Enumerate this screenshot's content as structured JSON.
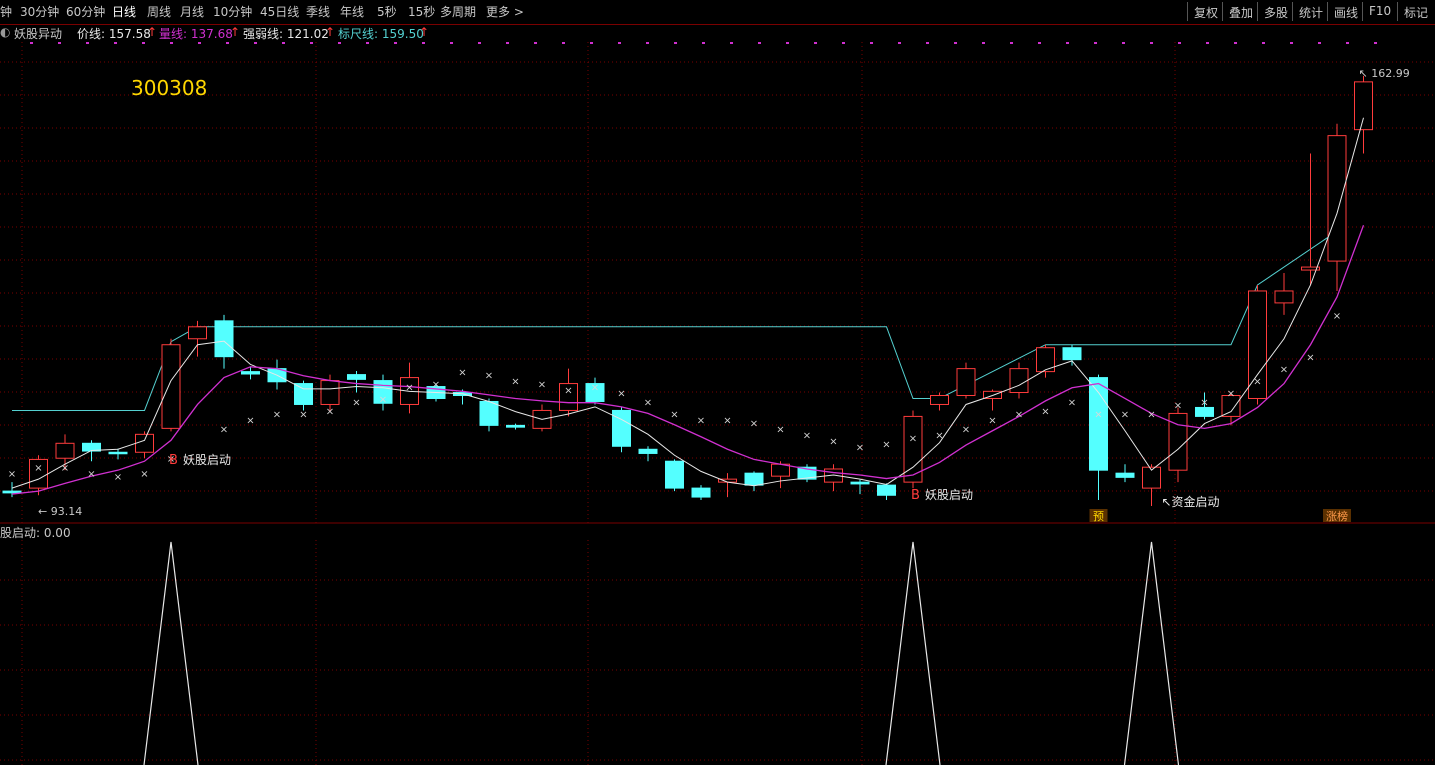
{
  "toolbar": {
    "periods": [
      "钟",
      "30分钟",
      "60分钟",
      "日线",
      "周线",
      "月线",
      "10分钟",
      "45日线",
      "季线",
      "年线",
      "5秒",
      "15秒",
      "多周期",
      "更多 >"
    ],
    "active_period": "日线",
    "right_buttons": [
      "复权",
      "叠加",
      "多股",
      "统计",
      "画线",
      "F10",
      "标记"
    ]
  },
  "legend": {
    "indicator_name": "妖股异动",
    "price_line": "价线: 157.58",
    "volume_line": "量线: 137.68",
    "strength_line": "强弱线: 121.02",
    "ruler_line": "标尺线: 159.50",
    "arrow": "↑"
  },
  "stock_code": "300308",
  "sub_indicator": "股启动: 0.00",
  "annotations": {
    "signal_b": "B",
    "yao_gu_qi_dong": "妖股启动",
    "zi_jin_qi_dong": "↖资金启动",
    "low_price": "93.14",
    "high_price": "162.99",
    "marker_yu": "预",
    "marker_zhang_bang": "涨榜"
  },
  "colors": {
    "up": "#ff3c3c",
    "down": "#54ffff",
    "ma_white": "#e8e8e8",
    "ma_magenta": "#d030d0",
    "ruler": "#54d0d0",
    "grid": "#7a0000",
    "yellow": "#ffd700"
  },
  "chart_data": {
    "type": "candlestick",
    "y_range": [
      90,
      167
    ],
    "candles": [
      [
        93.5,
        95.0,
        92.5,
        93.2
      ],
      [
        94.0,
        99.5,
        92.8,
        98.8
      ],
      [
        99.0,
        103.0,
        97.0,
        101.5
      ],
      [
        101.5,
        102.0,
        98.5,
        100.2
      ],
      [
        100.0,
        100.6,
        98.8,
        99.8
      ],
      [
        100.0,
        103.5,
        99.0,
        103.0
      ],
      [
        104.0,
        119.0,
        103.5,
        118.0
      ],
      [
        119.0,
        122.0,
        116.0,
        121.0
      ],
      [
        122.0,
        123.0,
        114.0,
        116.0
      ],
      [
        113.5,
        114.3,
        112.2,
        113.1
      ],
      [
        114.0,
        115.5,
        110.5,
        111.8
      ],
      [
        111.5,
        112.0,
        107.0,
        108.0
      ],
      [
        108.0,
        113.0,
        107.0,
        112.0
      ],
      [
        113.0,
        113.6,
        110.0,
        112.2
      ],
      [
        112.0,
        113.0,
        107.0,
        108.2
      ],
      [
        108.0,
        115.0,
        106.5,
        112.5
      ],
      [
        111.0,
        111.5,
        108.5,
        109.0
      ],
      [
        110.0,
        110.5,
        108.0,
        109.5
      ],
      [
        108.5,
        109.0,
        103.5,
        104.5
      ],
      [
        104.5,
        104.8,
        103.8,
        104.2
      ],
      [
        104.0,
        108.0,
        103.5,
        107.0
      ],
      [
        107.0,
        114.0,
        106.0,
        111.5
      ],
      [
        111.5,
        112.5,
        108.0,
        108.5
      ],
      [
        107.0,
        107.5,
        100.0,
        101.0
      ],
      [
        100.5,
        101.0,
        98.5,
        99.8
      ],
      [
        98.5,
        98.8,
        93.5,
        94.0
      ],
      [
        94.0,
        94.5,
        92.0,
        92.5
      ],
      [
        95.0,
        96.5,
        92.5,
        95.5
      ],
      [
        96.5,
        96.8,
        93.5,
        94.5
      ],
      [
        96.0,
        98.5,
        94.0,
        98.0
      ],
      [
        97.5,
        98.0,
        95.0,
        95.5
      ],
      [
        95.0,
        98.0,
        93.5,
        97.2
      ],
      [
        95.0,
        95.4,
        93.0,
        94.7
      ],
      [
        94.5,
        94.8,
        92.0,
        92.8
      ],
      [
        95.0,
        107.0,
        94.0,
        106.0
      ],
      [
        108.0,
        110.0,
        107.0,
        109.5
      ],
      [
        109.5,
        115.0,
        109.0,
        114.0
      ],
      [
        109.0,
        110.5,
        107.0,
        110.2
      ],
      [
        110.0,
        115.0,
        109.0,
        114.0
      ],
      [
        113.5,
        118.0,
        112.5,
        117.5
      ],
      [
        117.5,
        118.0,
        114.5,
        115.5
      ],
      [
        112.5,
        113.0,
        92.0,
        97.0
      ],
      [
        96.5,
        98.0,
        95.0,
        95.8
      ],
      [
        94.0,
        98.0,
        91.0,
        97.5
      ],
      [
        97.0,
        107.5,
        95.0,
        106.5
      ],
      [
        107.5,
        110.0,
        105.5,
        106.0
      ],
      [
        106.0,
        110.0,
        104.5,
        109.5
      ],
      [
        109.0,
        128.0,
        108.0,
        127.0
      ],
      [
        125.0,
        130.0,
        123.0,
        127.0
      ],
      [
        130.5,
        150.0,
        128.0,
        131.0
      ],
      [
        132.0,
        155.0,
        127.0,
        153.0
      ],
      [
        154.0,
        163.0,
        150.0,
        162.0
      ]
    ],
    "ma_white": [
      94.0,
      95.5,
      98.0,
      100.3,
      100.5,
      102.0,
      112.0,
      118.0,
      118.6,
      114.7,
      112.9,
      110.6,
      110.6,
      111.0,
      110.8,
      110.2,
      110.0,
      109.8,
      108.5,
      106.8,
      105.5,
      106.4,
      107.6,
      105.5,
      103.0,
      99.5,
      96.8,
      95.0,
      94.4,
      95.2,
      95.7,
      96.2,
      95.5,
      94.6,
      97.5,
      101.6,
      108.0,
      109.5,
      111.2,
      113.8,
      115.3,
      110.0,
      103.6,
      97.0,
      100.5,
      104.8,
      106.8,
      113.0,
      119.0,
      128.0,
      140.0,
      156.0
    ],
    "ma_magenta": [
      93.0,
      93.5,
      94.8,
      96.0,
      97.0,
      98.5,
      102.0,
      108.0,
      112.5,
      114.3,
      114.0,
      112.8,
      112.0,
      111.5,
      111.2,
      111.0,
      110.6,
      110.2,
      109.6,
      109.0,
      108.6,
      108.3,
      108.3,
      107.6,
      106.5,
      104.6,
      102.6,
      100.5,
      98.8,
      98.0,
      97.2,
      96.6,
      96.2,
      95.6,
      96.2,
      98.3,
      101.2,
      103.6,
      106.0,
      108.6,
      110.8,
      111.5,
      109.0,
      106.5,
      104.6,
      104.0,
      104.8,
      107.5,
      111.5,
      118.0,
      126.0,
      138.0
    ],
    "ruler": [
      [
        0,
        107
      ],
      [
        5,
        107
      ],
      [
        6,
        118.5
      ],
      [
        7,
        121
      ],
      [
        33,
        121
      ],
      [
        34,
        109
      ],
      [
        35,
        109
      ],
      [
        39,
        118
      ],
      [
        46,
        118
      ],
      [
        47,
        128
      ],
      [
        50,
        137
      ]
    ],
    "x_marks": [
      [
        0,
        96.5
      ],
      [
        1,
        97.5
      ],
      [
        2,
        97.5
      ],
      [
        3,
        96.5
      ],
      [
        4,
        96.0
      ],
      [
        5,
        96.5
      ],
      [
        6,
        99.0
      ],
      [
        8,
        104.0
      ],
      [
        9,
        105.5
      ],
      [
        10,
        106.5
      ],
      [
        11,
        106.5
      ],
      [
        12,
        107.0
      ],
      [
        13,
        108.5
      ],
      [
        14,
        109.0
      ],
      [
        15,
        111.0
      ],
      [
        16,
        111.5
      ],
      [
        17,
        113.5
      ],
      [
        18,
        113.0
      ],
      [
        19,
        112.0
      ],
      [
        20,
        111.5
      ],
      [
        21,
        110.5
      ],
      [
        22,
        111.0
      ],
      [
        23,
        110.0
      ],
      [
        24,
        108.5
      ],
      [
        25,
        106.5
      ],
      [
        26,
        105.5
      ],
      [
        27,
        105.5
      ],
      [
        28,
        105.0
      ],
      [
        29,
        104.0
      ],
      [
        30,
        103.0
      ],
      [
        31,
        102.0
      ],
      [
        32,
        101.0
      ],
      [
        33,
        101.5
      ],
      [
        34,
        102.5
      ],
      [
        35,
        103.0
      ],
      [
        36,
        104.0
      ],
      [
        37,
        105.5
      ],
      [
        38,
        106.5
      ],
      [
        39,
        107.0
      ],
      [
        40,
        108.5
      ],
      [
        41,
        106.5
      ],
      [
        42,
        106.5
      ],
      [
        43,
        106.5
      ],
      [
        44,
        108.0
      ],
      [
        45,
        108.5
      ],
      [
        46,
        110.0
      ],
      [
        47,
        112.0
      ],
      [
        48,
        114.0
      ],
      [
        49,
        116.0
      ],
      [
        50,
        123.0
      ]
    ]
  }
}
